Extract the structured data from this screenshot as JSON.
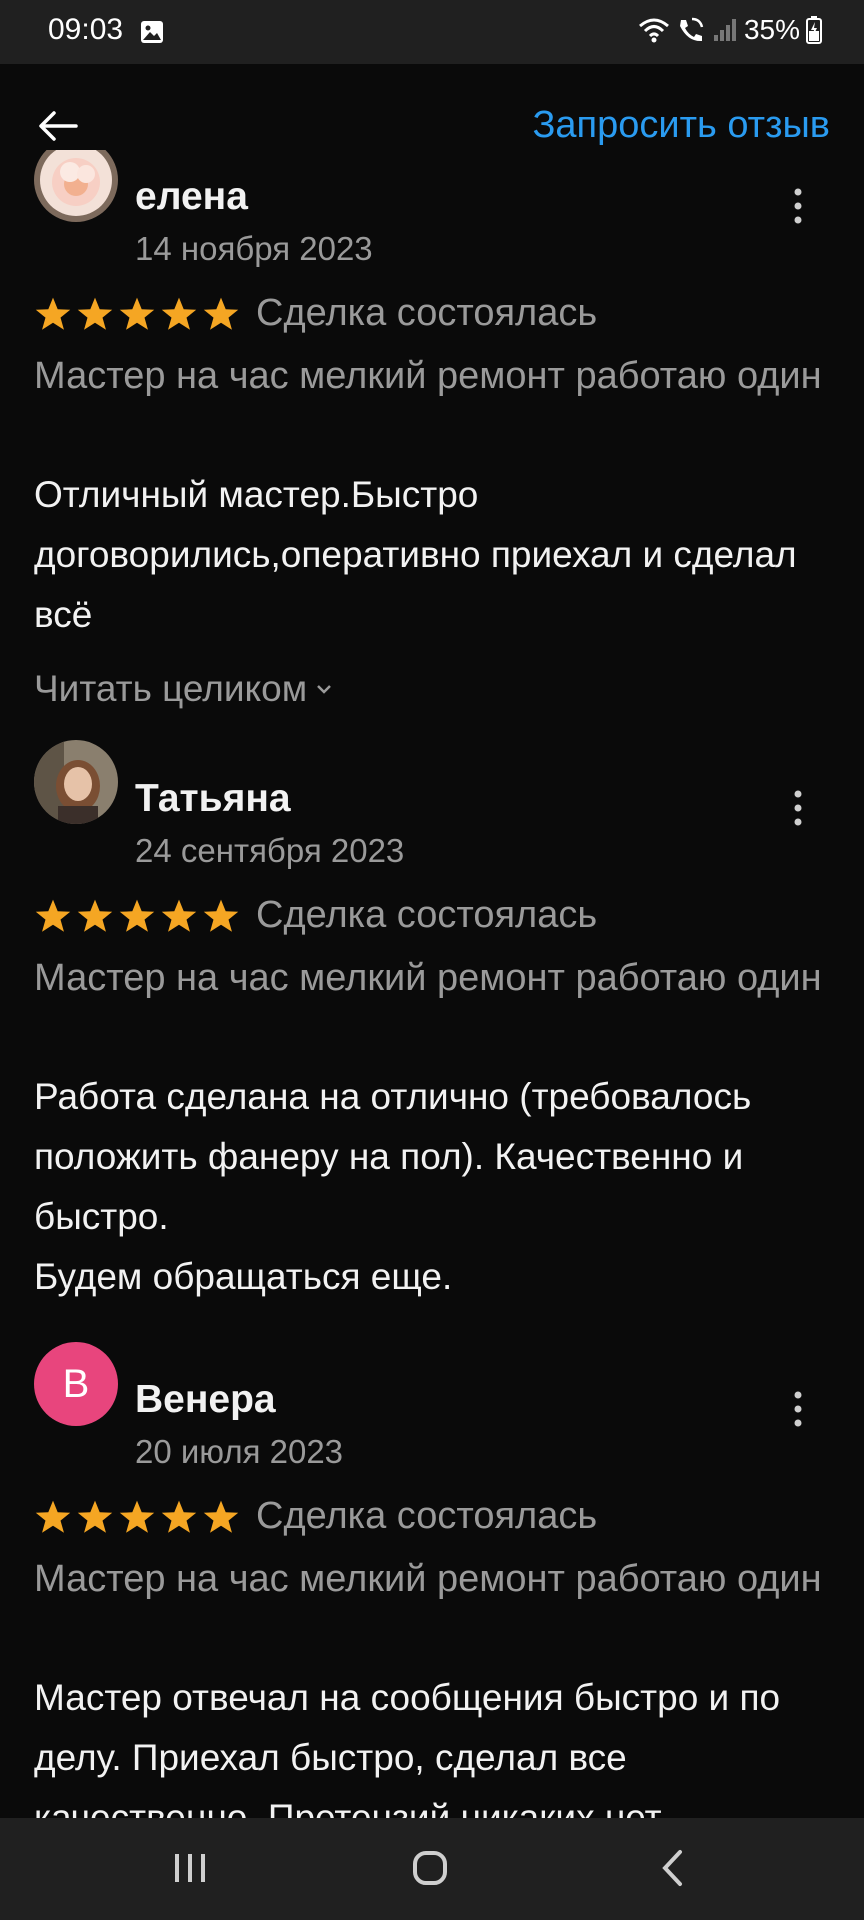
{
  "status_bar": {
    "time": "09:03",
    "battery": "35%",
    "icons": [
      "gallery-icon",
      "wifi-icon",
      "wifi-calling-icon",
      "signal-icon",
      "battery-charging-icon"
    ]
  },
  "header": {
    "back_icon": "arrow-left-icon",
    "request_review_label": "Запросить отзыв",
    "accent_color": "#2a9bf0"
  },
  "reviews": [
    {
      "author": "елена",
      "date": "14 ноября 2023",
      "rating": 5,
      "deal_status": "Сделка состоялась",
      "service": "Мастер на час мелкий ремонт работаю один",
      "text": "Отличный мастер.Быстро договорились,оперативно приехал и сделал всё",
      "read_more": "Читать целиком"
    },
    {
      "author": "Татьяна",
      "date": "24 сентября 2023",
      "rating": 5,
      "deal_status": "Сделка состоялась",
      "service": "Мастер на час мелкий ремонт работаю один",
      "text": "Работа сделана на отлично (требовалось положить фанеру на пол). Качественно и быстро.\nБудем обращаться еще."
    },
    {
      "author": "Венера",
      "avatar_letter": "В",
      "date": "20 июля 2023",
      "rating": 5,
      "deal_status": "Сделка состоялась",
      "service": "Мастер на час мелкий ремонт работаю один",
      "text": "Мастер отвечал на сообщения быстро и по делу. Приехал быстро, сделал все качественно. Претензий никаких нет."
    }
  ],
  "colors": {
    "star": "#f5a623",
    "avatar_letter_bg": "#e8457d",
    "secondary_text": "#9a9a9a"
  },
  "nav_bar": {
    "icons": [
      "recent-apps-icon",
      "home-icon",
      "back-nav-icon"
    ]
  }
}
